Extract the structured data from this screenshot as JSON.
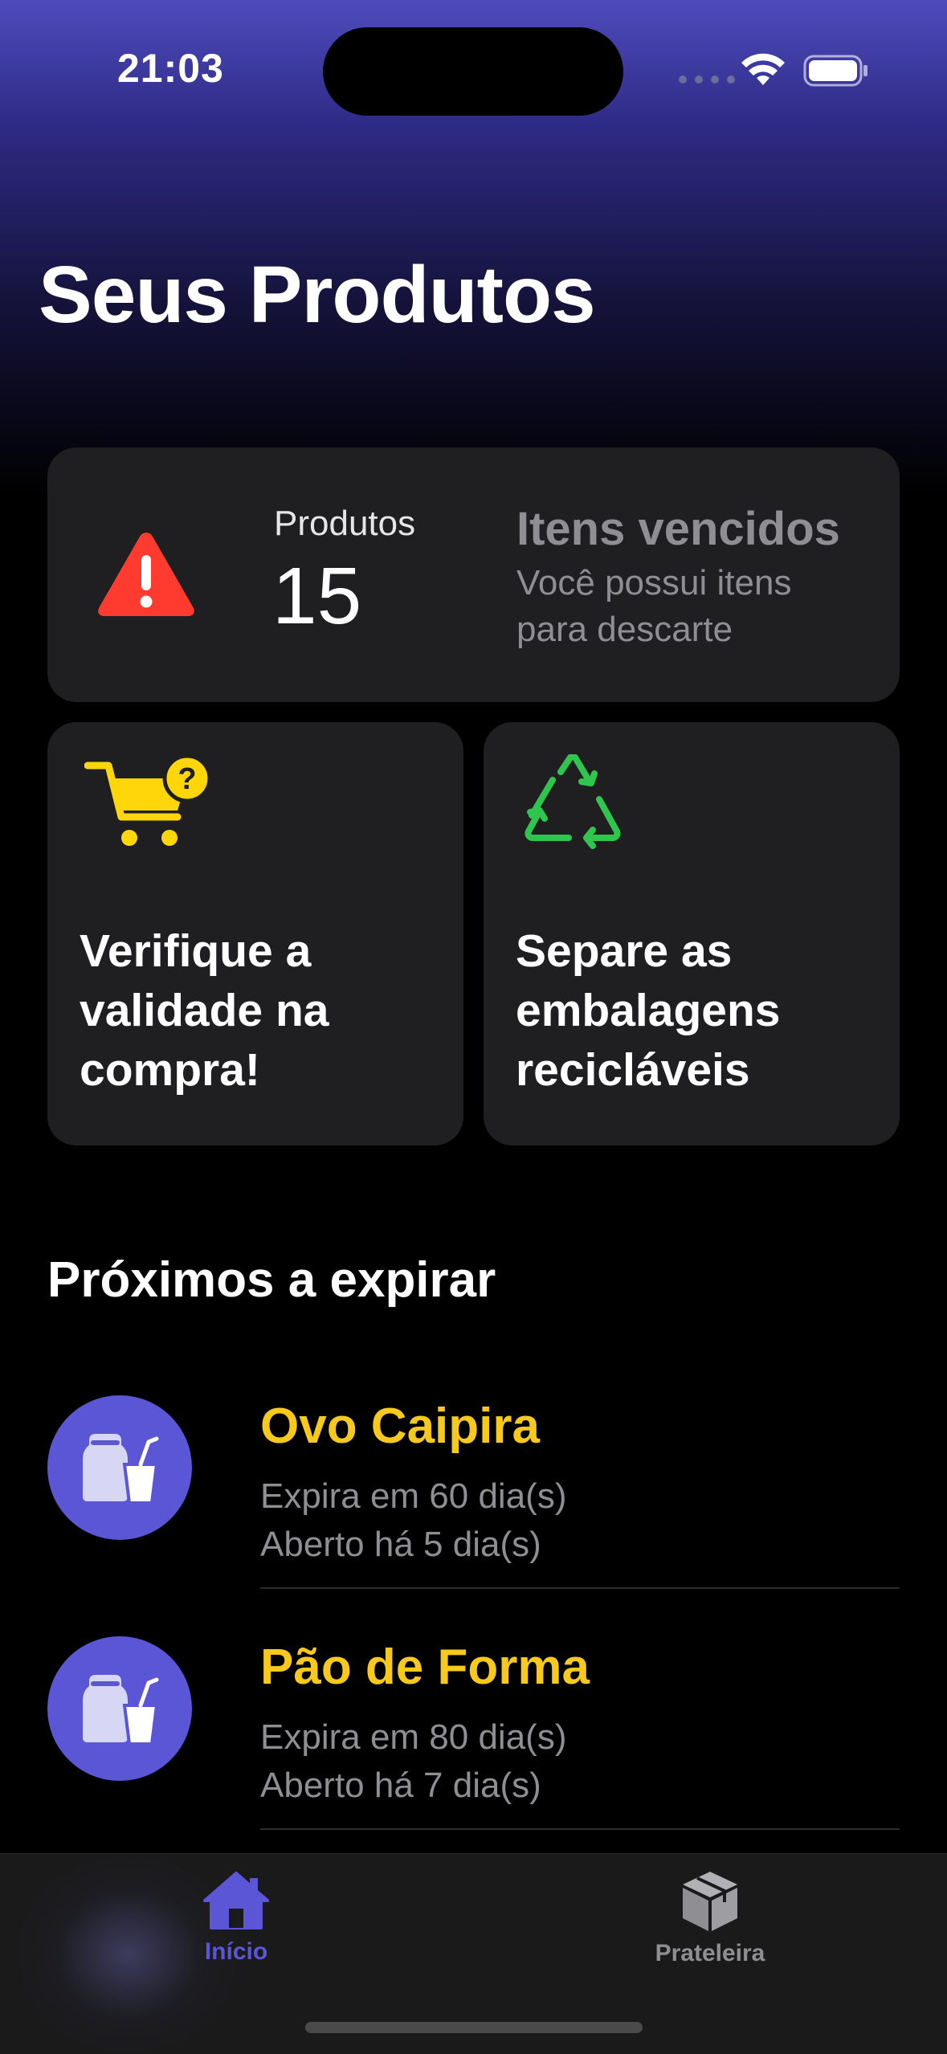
{
  "status": {
    "time": "21:03"
  },
  "header": {
    "title": "Seus Produtos"
  },
  "summary": {
    "products_label": "Produtos",
    "products_count": "15",
    "expired_title": "Itens vencidos",
    "expired_desc": "Você possui itens para descarte"
  },
  "tips": [
    {
      "text": "Verifique a validade na compra!",
      "icon": "cart-question-icon"
    },
    {
      "text": "Separe as embalagens recicláveis",
      "icon": "recycle-icon"
    }
  ],
  "section": {
    "title": "Próximos a expirar"
  },
  "items": [
    {
      "name": "Ovo Caipira",
      "expires": "Expira em 60 dia(s)",
      "opened": "Aberto há 5 dia(s)"
    },
    {
      "name": "Pão de Forma",
      "expires": "Expira em 80 dia(s)",
      "opened": "Aberto há 7 dia(s)"
    }
  ],
  "tabs": [
    {
      "label": "Início",
      "icon": "house-icon",
      "active": true
    },
    {
      "label": "Prateleira",
      "icon": "box-icon",
      "active": false
    }
  ],
  "colors": {
    "accent": "#5b56d6",
    "warning": "#ff3b30",
    "product_name": "#f7c91c",
    "recycle": "#30c54f",
    "cart": "#ffd60a"
  }
}
